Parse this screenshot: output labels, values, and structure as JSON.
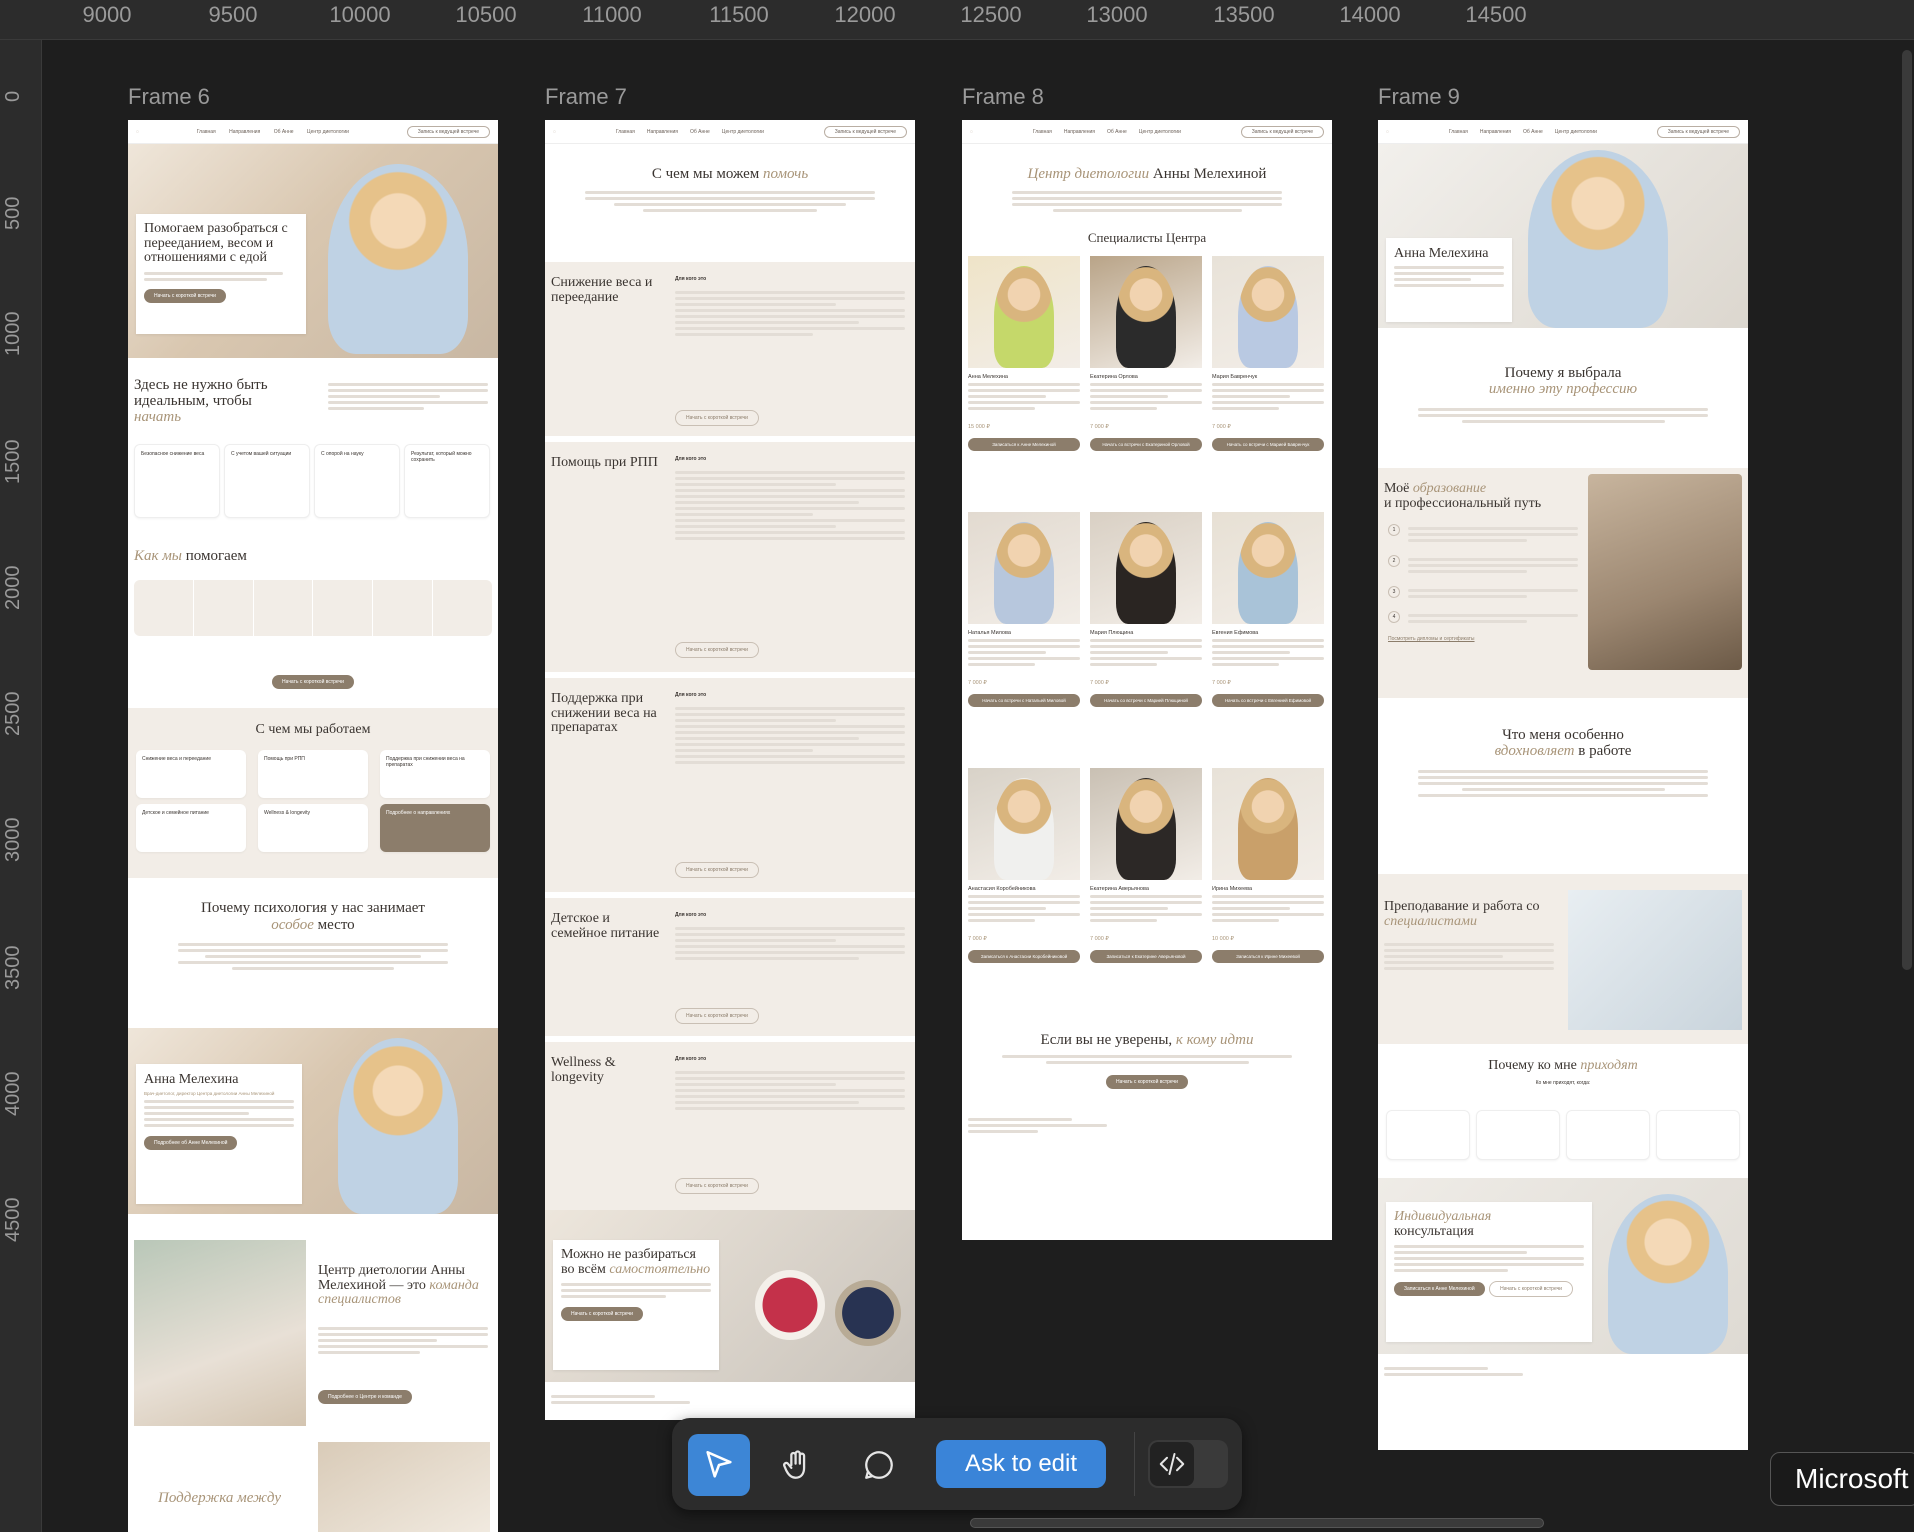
{
  "ruler": {
    "top": [
      "9000",
      "9500",
      "10000",
      "10500",
      "11000",
      "11500",
      "12000",
      "12500",
      "13000",
      "13500",
      "14000",
      "14500"
    ],
    "left": [
      "0",
      "500",
      "1000",
      "1500",
      "2000",
      "2500",
      "3000",
      "3500",
      "4000",
      "4500"
    ]
  },
  "frames": {
    "f6": {
      "label": "Frame 6"
    },
    "f7": {
      "label": "Frame 7"
    },
    "f8": {
      "label": "Frame 8"
    },
    "f9": {
      "label": "Frame 9"
    }
  },
  "nav": {
    "links": [
      "Главная",
      "Направления",
      "Об Анне",
      "Центр диетологии"
    ],
    "cta": "Запись к ведущей встрече"
  },
  "frame6": {
    "hero_title": "Помогаем разобраться с перееданием, весом и отношениями с едой",
    "hero_button": "Начать с короткой встречи",
    "ideal_title": "Здесь не нужно быть идеальным, чтобы",
    "ideal_accent": "начать",
    "features": [
      "Безопасное снижение веса",
      "С учетом вашей ситуации",
      "С опорой на науку",
      "Результат, который можно сохранить"
    ],
    "how_title": "Как мы",
    "how_accent": "помогаем",
    "how_button": "Начать с короткой встречи",
    "work_title": "С чем мы работаем",
    "work_tiles": [
      "Снижение веса и переедание",
      "Помощь при РПП",
      "Поддержка при снижении веса на препаратах",
      "Детское и семейное питание",
      "Wellness & longevity",
      "Подробнее о направлениях"
    ],
    "psy_title": "Почему психология у нас занимает",
    "psy_accent": "особое",
    "psy_tail": "место",
    "anna_name": "Анна Мелехина",
    "anna_role": "Врач-диетолог, директор Центра диетологии Анны Мелехиной",
    "anna_button": "Подробнее об Анне Мелехиной",
    "center_title": "Центр диетологии Анны Мелехиной — это",
    "center_accent": "команда специалистов",
    "center_button": "Подробнее о Центре и команде",
    "support_title": "Поддержка между"
  },
  "frame7": {
    "title": "С чем мы можем",
    "title_accent": "помочь",
    "sections": [
      "Снижение веса и переедание",
      "Помощь при РПП",
      "Поддержка при снижении веса на препаратах",
      "Детское и семейное питание",
      "Wellness & longevity"
    ],
    "for_whom": "Для кого это",
    "button": "Начать с короткой встречи",
    "bottom_title": "Можно не разбираться во всём",
    "bottom_accent": "самостоятельно",
    "bottom_button": "Начать с короткой встречи"
  },
  "frame8": {
    "title_accent": "Центр диетологии",
    "title": "Анны Мелехиной",
    "specialists_title": "Специалисты Центра",
    "specialists": [
      {
        "name": "Анна Мелехина",
        "price": "15 000 ₽",
        "button": "Записаться к Анне Мелехиной"
      },
      {
        "name": "Екатерина Орлова",
        "price": "7 000 ₽",
        "button": "Начать со встречи с Екатериной Орловой"
      },
      {
        "name": "Мария Бавренчук",
        "price": "7 000 ₽",
        "button": "Начать со встречи с Марией Бавренчук"
      },
      {
        "name": "Наталья Милова",
        "price": "7 000 ₽",
        "button": "Начать со встречи с Натальей Миловой"
      },
      {
        "name": "Мария Плющина",
        "price": "7 000 ₽",
        "button": "Начать со встречи с Марией Плющиной"
      },
      {
        "name": "Евгения Ефимова",
        "price": "7 000 ₽",
        "button": "Начать со встречи с Евгенией Ефимовой"
      },
      {
        "name": "Анастасия Коробейникова",
        "price": "7 000 ₽",
        "button": "Записаться к Анастасии Коробейниковой"
      },
      {
        "name": "Екатерина Аверьянова",
        "price": "7 000 ₽",
        "button": "Записаться к Екатерине Аверьяновой"
      },
      {
        "name": "Ирина Михеева",
        "price": "10 000 ₽",
        "button": "Записаться к Ирине Михеевой"
      }
    ],
    "unsure_title": "Если вы не уверены,",
    "unsure_accent": "к кому идти",
    "unsure_button": "Начать с короткой встречи"
  },
  "frame9": {
    "name": "Анна Мелехина",
    "why_title": "Почему я выбрала",
    "why_accent": "именно эту профессию",
    "edu_title_a": "Моё",
    "edu_accent": "образование",
    "edu_title_b": "и профессиональный путь",
    "edu_steps": [
      "1",
      "2",
      "3",
      "4"
    ],
    "edu_link": "Посмотреть дипломы и сертификаты",
    "inspire_title": "Что меня особенно",
    "inspire_accent": "вдохновляет",
    "inspire_tail": "в работе",
    "teach_title": "Преподавание и работа со",
    "teach_accent": "специалистами",
    "come_title": "Почему ко мне",
    "come_accent": "приходят",
    "come_sub": "Ко мне приходят, когда:",
    "consult_title_accent": "Индивидуальная",
    "consult_title": "консультация",
    "consult_button": "Записаться к Анне Мелехиной",
    "consult_button2": "Начать с короткой встречи"
  },
  "toolbar": {
    "ask": "Ask to edit"
  },
  "tooltip": "Microsoft"
}
